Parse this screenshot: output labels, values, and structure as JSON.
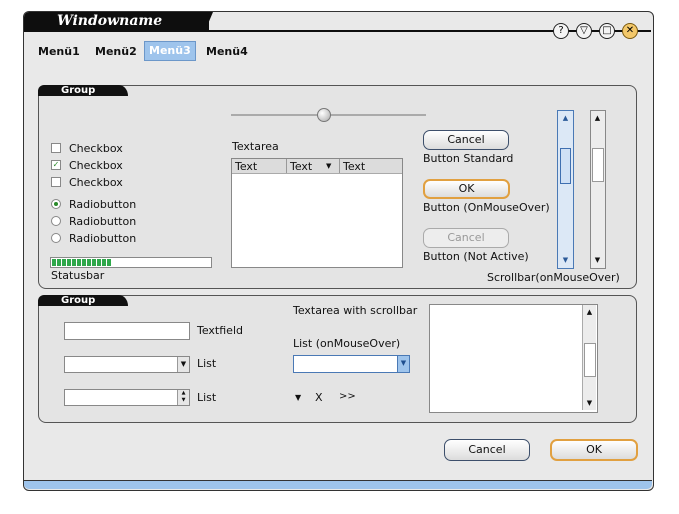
{
  "window": {
    "title": "Windowname"
  },
  "menu": [
    "Menü1",
    "Menü2",
    "Menü3",
    "Menü4"
  ],
  "group1": {
    "title": "Group",
    "checkboxes": [
      {
        "label": "Checkbox",
        "checked": false
      },
      {
        "label": "Checkbox",
        "checked": true
      },
      {
        "label": "Checkbox",
        "checked": false
      }
    ],
    "radios": [
      {
        "label": "Radiobutton",
        "selected": true
      },
      {
        "label": "Radiobutton",
        "selected": false
      },
      {
        "label": "Radiobutton",
        "selected": false
      }
    ],
    "statusbar_label": "Statusbar",
    "statusbar_progress": 0.37,
    "textarea_label": "Textarea",
    "table_headers": [
      "Text",
      "Text",
      "Text"
    ],
    "btn_standard": "Cancel",
    "btn_standard_caption": "Button Standard",
    "btn_hover": "OK",
    "btn_hover_caption": "Button (OnMouseOver)",
    "btn_disabled": "Cancel",
    "btn_disabled_caption": "Button (Not Active)",
    "scrollbar_caption": "Scrollbar(onMouseOver)"
  },
  "group2": {
    "title": "Group",
    "textfield_label": "Textfield",
    "list_label_1": "List",
    "list_label_2": "List",
    "textarea_scroll_label": "Textarea with scrollbar",
    "list_hover_label": "List (onMouseOver)",
    "icons": {
      "down": "▼",
      "close": "X",
      "next": ">>"
    }
  },
  "footer": {
    "cancel": "Cancel",
    "ok": "OK"
  },
  "colors": {
    "accent_blue": "#9ec4ec",
    "hover_orange": "#e1a040",
    "progress_green": "#2ea84a",
    "titlebar": "#0e0e0e"
  }
}
